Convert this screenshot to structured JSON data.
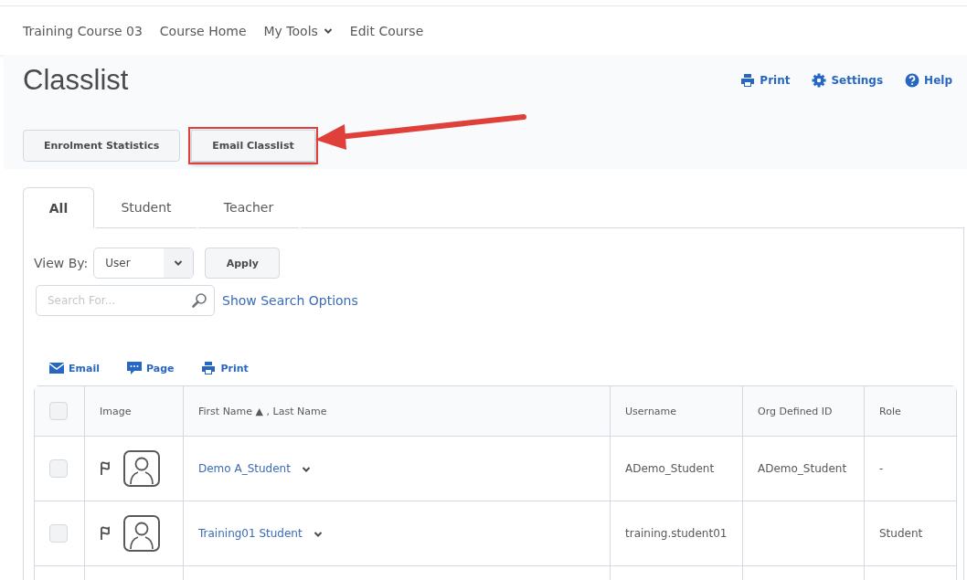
{
  "nav": {
    "items": [
      {
        "label": "Training Course 03",
        "dropdown": false
      },
      {
        "label": "Course Home",
        "dropdown": false
      },
      {
        "label": "My Tools",
        "dropdown": true
      },
      {
        "label": "Edit Course",
        "dropdown": false
      }
    ]
  },
  "header": {
    "title": "Classlist",
    "actions": [
      {
        "kind": "print",
        "label": "Print"
      },
      {
        "kind": "settings",
        "label": "Settings"
      },
      {
        "kind": "help",
        "label": "Help"
      }
    ]
  },
  "buttons": [
    {
      "label": "Enrolment Statistics",
      "highlighted": false
    },
    {
      "label": "Email Classlist",
      "highlighted": true
    }
  ],
  "tabs": [
    {
      "label": "All",
      "selected": true
    },
    {
      "label": "Student",
      "selected": false
    },
    {
      "label": "Teacher",
      "selected": false
    }
  ],
  "view_by": {
    "label": "View By:",
    "value": "User",
    "apply": "Apply"
  },
  "search": {
    "placeholder": "Search For...",
    "options_link": "Show Search Options"
  },
  "toolbar": [
    {
      "kind": "email",
      "label": "Email"
    },
    {
      "kind": "page",
      "label": "Page"
    },
    {
      "kind": "print",
      "label": "Print"
    }
  ],
  "table": {
    "select_all_checked": false,
    "columns": [
      "Image",
      "First Name ▲ , Last Name",
      "Username",
      "Org Defined ID",
      "Role"
    ],
    "rows": [
      {
        "checked": false,
        "name": "Demo A_Student",
        "username": "ADemo_Student",
        "org_id": "ADemo_Student",
        "role": "-"
      },
      {
        "checked": false,
        "name": "Training01 Student",
        "username": "training.student01",
        "org_id": "",
        "role": "Student"
      }
    ]
  }
}
